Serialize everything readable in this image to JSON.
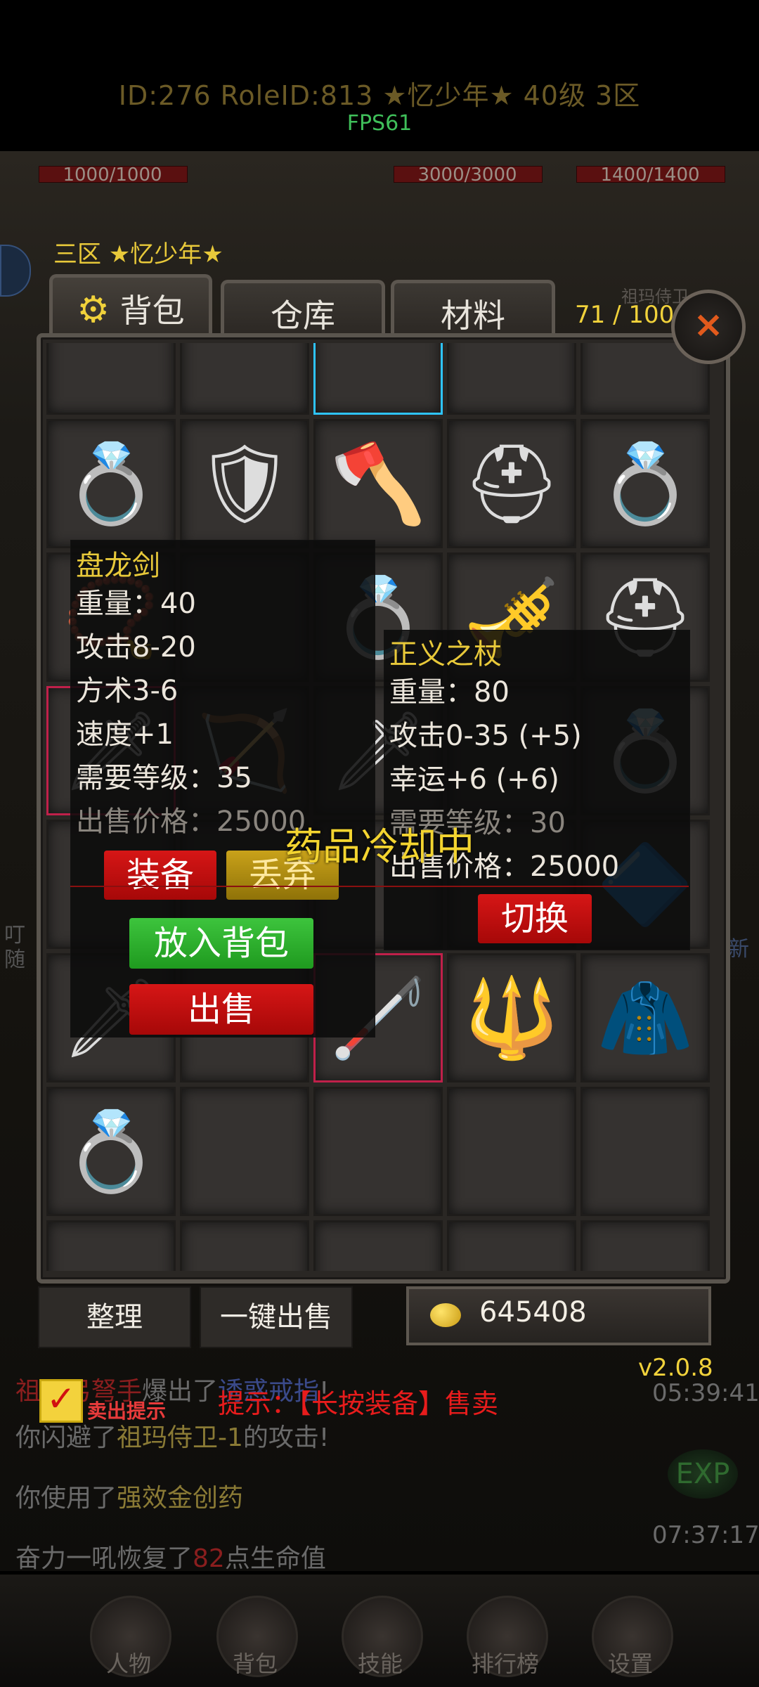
{
  "header": {
    "id_line": "ID:276  RoleID:813  ★忆少年★  40级  3区",
    "fps": "FPS61"
  },
  "hud": {
    "hp_left": "1000/1000",
    "hp_mid": "3000/3000",
    "hp_right": "1400/1400",
    "server_player": "三区  ★忆少年★",
    "enemy_name": "祖玛侍卫"
  },
  "bag": {
    "tabs": [
      "背包",
      "仓库",
      "材料"
    ],
    "capacity": "71 / 100",
    "close_label": "×"
  },
  "items": [
    {
      "name": "gold-ring",
      "icon": "💍"
    },
    {
      "name": "armor",
      "icon": "🛡"
    },
    {
      "name": "battle-axe",
      "icon": "🪓"
    },
    {
      "name": "helmet",
      "icon": "⛑"
    },
    {
      "name": "blue-gem-ring",
      "icon": "💍"
    },
    {
      "name": "necklace",
      "icon": "📿"
    },
    {
      "name": "empty",
      "icon": ""
    },
    {
      "name": "red-ring",
      "icon": "💍"
    },
    {
      "name": "flute",
      "icon": "🎺"
    },
    {
      "name": "bronze-helmet",
      "icon": "⛑"
    },
    {
      "name": "sword-highlighted",
      "icon": "🗡"
    },
    {
      "name": "bow",
      "icon": "🏹"
    },
    {
      "name": "dagger",
      "icon": "🗡"
    },
    {
      "name": "empty",
      "icon": ""
    },
    {
      "name": "green-ring",
      "icon": "💍"
    },
    {
      "name": "empty",
      "icon": ""
    },
    {
      "name": "empty",
      "icon": ""
    },
    {
      "name": "empty",
      "icon": ""
    },
    {
      "name": "empty",
      "icon": ""
    },
    {
      "name": "blue-item",
      "icon": "🔷"
    },
    {
      "name": "sword",
      "icon": "🗡"
    },
    {
      "name": "empty",
      "icon": ""
    },
    {
      "name": "staff-selected",
      "icon": "🦯"
    },
    {
      "name": "trident",
      "icon": "🔱"
    },
    {
      "name": "robe",
      "icon": "🧥"
    },
    {
      "name": "red-ring",
      "icon": "💍"
    }
  ],
  "tooltip_left": {
    "title": "盘龙剑",
    "lines": [
      "重量：40",
      "攻击8-20",
      "方术3-6",
      "速度+1",
      "需要等级：35",
      "出售价格：25000"
    ],
    "btn_equip": "装备",
    "btn_drop": "丢弃",
    "btn_put_bag": "放入背包",
    "btn_sell": "出售"
  },
  "tooltip_right": {
    "title": "正义之杖",
    "lines": [
      "重量：80",
      "攻击0-35 (+5)",
      "幸运+6 (+6)",
      "需要等级：30",
      "出售价格：25000"
    ],
    "btn_switch": "切换"
  },
  "cooldown_text": "药品冷却中",
  "controls": {
    "sort": "整理",
    "sell_all": "一键出售",
    "gold": "645408",
    "version": "v2.0.8",
    "sell_tip_label": "卖出提示",
    "hint": "提示：【长按装备】售卖"
  },
  "chat": {
    "line1_a": "祖玛弓弩手",
    "line1_b": "爆出了",
    "line1_c": "诱惑戒指",
    "line1_d": "!",
    "line2_a": "你闪避了",
    "line2_b": "祖玛侍卫-1",
    "line2_c": "的攻击!",
    "line3_a": "你使用了",
    "line3_b": "强效金创药",
    "line4_a": "奋力一吼恢复了",
    "line4_b": "82",
    "line4_c": "点生命值",
    "time1": "05:39:41",
    "time2": "07:37:17",
    "side_left": "叮",
    "side_left2": "随",
    "side_right": "新",
    "exp_label": "EXP"
  },
  "bottom_nav": [
    "人物",
    "背包",
    "技能",
    "排行榜",
    "设置"
  ],
  "colors": {
    "gold_text": "#e8c93a",
    "red_button": "#c40f0f",
    "green_button": "#2fb12f",
    "hint_red": "#e81c1c"
  }
}
